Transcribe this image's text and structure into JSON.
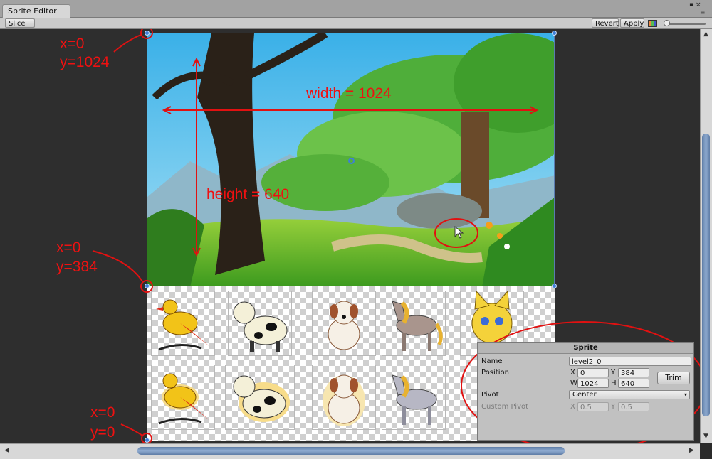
{
  "window": {
    "tab_title": "Sprite Editor",
    "menu_glyph": "▪ ×",
    "list_glyph": "≡"
  },
  "toolbar": {
    "slice_label": "Slice ≑",
    "revert_label": "Revert",
    "apply_label": "Apply"
  },
  "annotations": {
    "top_left_x": "x=0",
    "top_left_y": "y=1024",
    "mid_left_x": "x=0",
    "mid_left_y": "y=384",
    "bottom_left_x": "x=0",
    "bottom_left_y": "y=0",
    "width_label": "width = 1024",
    "height_label": "height = 640",
    "color": "#e11111"
  },
  "inspector": {
    "title": "Sprite",
    "name_label": "Name",
    "name_value": "level2_0",
    "position_label": "Position",
    "x_label": "X",
    "x_value": "0",
    "y_label": "Y",
    "y_value": "384",
    "w_label": "W",
    "w_value": "1024",
    "h_label": "H",
    "h_value": "640",
    "trim_label": "Trim",
    "pivot_label": "Pivot",
    "pivot_value": "Center",
    "custom_pivot_label": "Custom Pivot",
    "cp_x_label": "X",
    "cp_x_value": "0.5",
    "cp_y_label": "Y",
    "cp_y_value": "0.5"
  },
  "sprites": [
    {
      "name": "bird-sprite",
      "color": "#f2c318"
    },
    {
      "name": "cow-sprite",
      "color": "#f4f0d8"
    },
    {
      "name": "dog-sprite",
      "color": "#f6f0e6"
    },
    {
      "name": "horse-sprite",
      "color": "#a9958d"
    },
    {
      "name": "cat-sprite",
      "color": "#f4d23a"
    }
  ],
  "colors": {
    "handle": "#3f7fd6",
    "accent_scroll": "#6f8fba"
  }
}
